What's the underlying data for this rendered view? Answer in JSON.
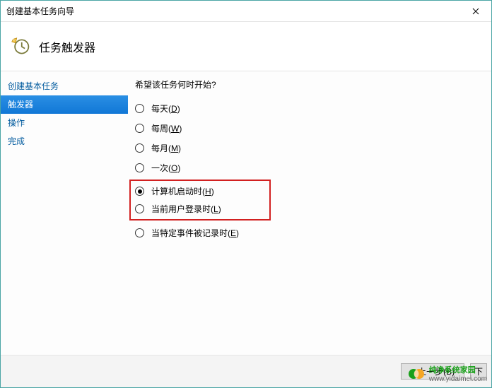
{
  "window": {
    "title": "创建基本任务向导"
  },
  "header": {
    "title": "任务触发器"
  },
  "sidebar": {
    "items": [
      {
        "label": "创建基本任务",
        "selected": false
      },
      {
        "label": "触发器",
        "selected": true
      },
      {
        "label": "操作",
        "selected": false
      },
      {
        "label": "完成",
        "selected": false
      }
    ]
  },
  "content": {
    "prompt": "希望该任务何时开始?",
    "options": [
      {
        "label": "每天",
        "mnemonic": "D",
        "selected": false,
        "highlight": false
      },
      {
        "label": "每周",
        "mnemonic": "W",
        "selected": false,
        "highlight": false
      },
      {
        "label": "每月",
        "mnemonic": "M",
        "selected": false,
        "highlight": false
      },
      {
        "label": "一次",
        "mnemonic": "O",
        "selected": false,
        "highlight": false
      },
      {
        "label": "计算机启动时",
        "mnemonic": "H",
        "selected": true,
        "highlight": true
      },
      {
        "label": "当前用户登录时",
        "mnemonic": "L",
        "selected": false,
        "highlight": true
      },
      {
        "label": "当特定事件被记录时",
        "mnemonic": "E",
        "selected": false,
        "highlight": false
      }
    ]
  },
  "footer": {
    "back": "< 上一步(B)",
    "next_partial": "下"
  },
  "watermark": {
    "line1": "纯净系统家园",
    "line2": "www.yidaimei.com"
  }
}
